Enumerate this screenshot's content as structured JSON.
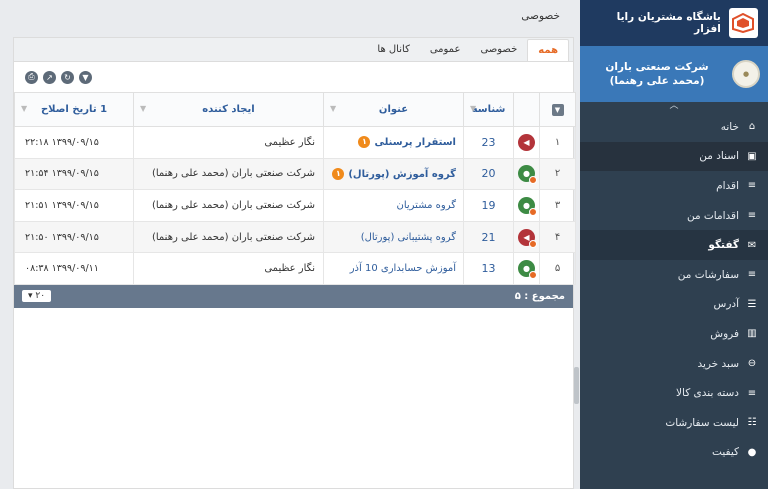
{
  "sidebar": {
    "brand_title": "باشگاه مشتریان رایا افزار",
    "profile_name": "شرکت صنعتی باران (محمد علی رهنما)",
    "items": [
      {
        "label": "خانه",
        "icon": "home-icon",
        "glyph": "⌂"
      },
      {
        "label": "اسناد من",
        "icon": "documents-icon",
        "glyph": "▣"
      },
      {
        "label": "اقدام",
        "icon": "action-icon",
        "glyph": "≡"
      },
      {
        "label": "اقدامات من",
        "icon": "my-actions-icon",
        "glyph": "≡"
      },
      {
        "label": "گفتگو",
        "icon": "chat-icon",
        "glyph": "✉"
      },
      {
        "label": "سفارشات من",
        "icon": "orders-icon",
        "glyph": "≡"
      },
      {
        "label": "آدرس",
        "icon": "address-icon",
        "glyph": "☰"
      },
      {
        "label": "فروش",
        "icon": "sales-icon",
        "glyph": "▥"
      },
      {
        "label": "سبد خرید",
        "icon": "cart-icon",
        "glyph": "⊖"
      },
      {
        "label": "دسته بندی کالا",
        "icon": "category-icon",
        "glyph": "≡"
      },
      {
        "label": "لیست سفارشات",
        "icon": "order-list-icon",
        "glyph": "☷"
      },
      {
        "label": "کیفیت",
        "icon": "quality-icon",
        "glyph": "●"
      }
    ]
  },
  "breadcrumb": "خصوصی",
  "tabs": [
    "همه",
    "خصوصی",
    "عمومی",
    "کانال ها"
  ],
  "columns": {
    "id": "شناسه",
    "title": "عنوان",
    "created_by": "ایجاد کننده",
    "modified": "تاریخ اصلاح",
    "sort_index": "1"
  },
  "rows": [
    {
      "idx": "۱",
      "icon": "red",
      "id": "23",
      "title": "استقرار پرسنلی",
      "bold": true,
      "badge": "۱",
      "by": "نگار عظیمی",
      "date": "۱۳۹۹/۰۹/۱۵ ۲۲:۱۸"
    },
    {
      "idx": "۲",
      "icon": "green",
      "id": "20",
      "title": "گروه آموزش (پورتال)",
      "bold": true,
      "badge": "۱",
      "by": "شرکت صنعتی باران (محمد علی رهنما)",
      "date": "۱۳۹۹/۰۹/۱۵ ۲۱:۵۴"
    },
    {
      "idx": "۳",
      "icon": "green",
      "id": "19",
      "title": "گروه مشتریان",
      "bold": false,
      "badge": "",
      "by": "شرکت صنعتی باران (محمد علی رهنما)",
      "date": "۱۳۹۹/۰۹/۱۵ ۲۱:۵۱"
    },
    {
      "idx": "۴",
      "icon": "red",
      "id": "21",
      "title": "گروه پشتیبانی (پورتال)",
      "bold": false,
      "badge": "",
      "by": "شرکت صنعتی باران (محمد علی رهنما)",
      "date": "۱۳۹۹/۰۹/۱۵ ۲۱:۵۰"
    },
    {
      "idx": "۵",
      "icon": "green",
      "id": "13",
      "title": "آموزش حسابداری 10 آذر",
      "bold": false,
      "badge": "",
      "by": "نگار عظیمی",
      "date": "۱۳۹۹/۰۹/۱۱ ۰۸:۳۸"
    }
  ],
  "footer": {
    "total_label": "مجموع : ۵",
    "page_size": "۲۰"
  }
}
